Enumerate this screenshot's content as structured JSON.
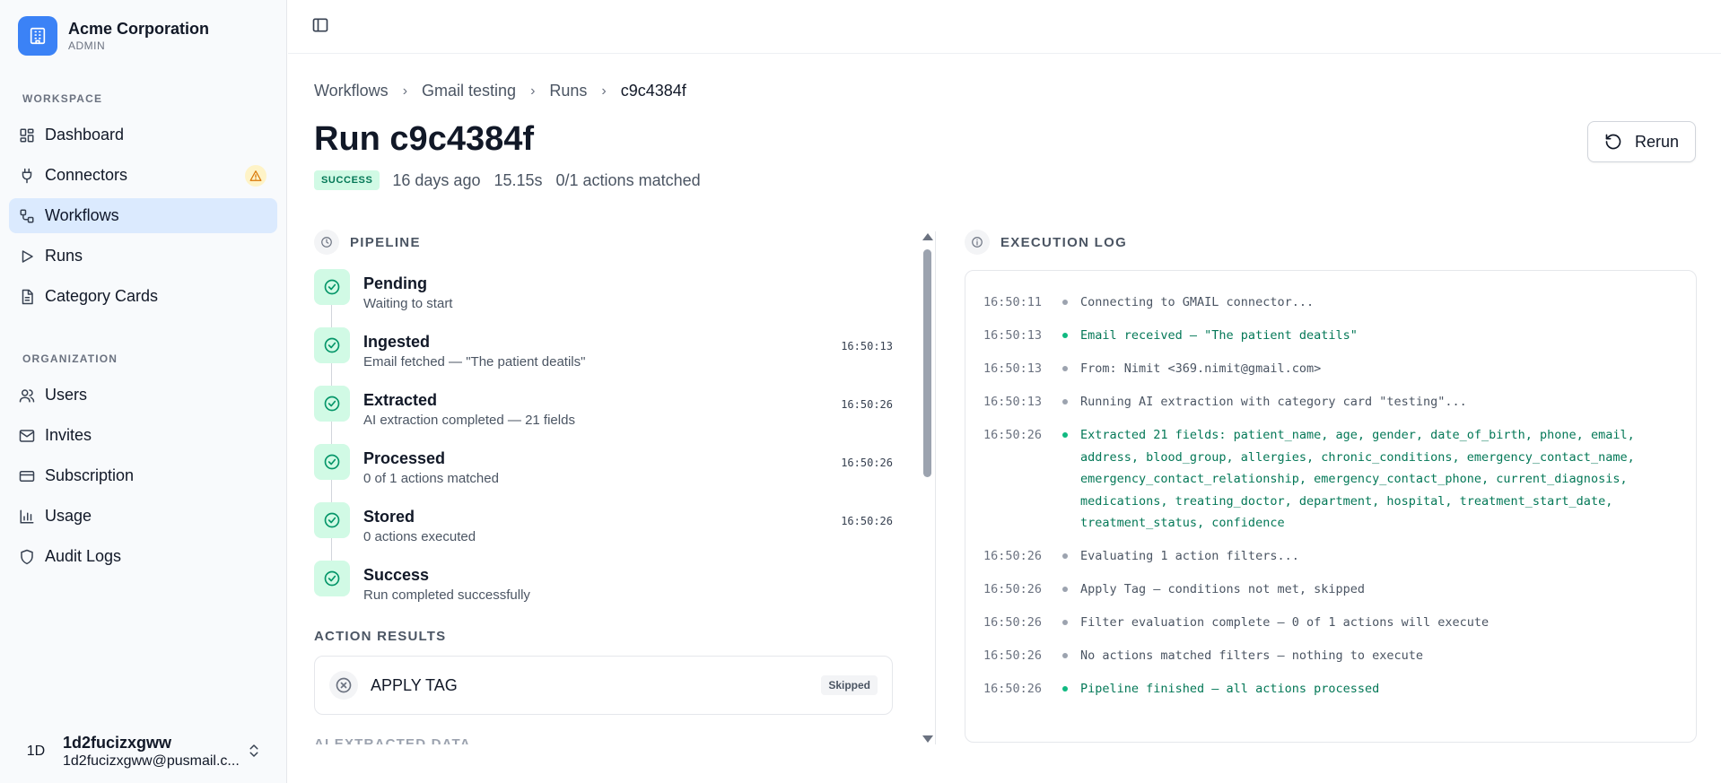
{
  "org": {
    "name": "Acme Corporation",
    "role": "ADMIN"
  },
  "sidebar": {
    "workspace_label": "WORKSPACE",
    "workspace_items": [
      {
        "label": "Dashboard",
        "icon": "dashboard-icon"
      },
      {
        "label": "Connectors",
        "icon": "plug-icon",
        "warning": true
      },
      {
        "label": "Workflows",
        "icon": "workflow-icon",
        "active": true
      },
      {
        "label": "Runs",
        "icon": "play-icon"
      },
      {
        "label": "Category Cards",
        "icon": "document-icon"
      }
    ],
    "organization_label": "ORGANIZATION",
    "organization_items": [
      {
        "label": "Users",
        "icon": "users-icon"
      },
      {
        "label": "Invites",
        "icon": "mail-icon"
      },
      {
        "label": "Subscription",
        "icon": "credit-card-icon"
      },
      {
        "label": "Usage",
        "icon": "bar-chart-icon"
      },
      {
        "label": "Audit Logs",
        "icon": "shield-icon"
      }
    ]
  },
  "user": {
    "initials": "1D",
    "name": "1d2fucizxgww",
    "email": "1d2fucizxgww@pusmail.c..."
  },
  "breadcrumb": [
    "Workflows",
    "Gmail testing",
    "Runs",
    "c9c4384f"
  ],
  "run": {
    "title": "Run c9c4384f",
    "status": "SUCCESS",
    "age": "16 days ago",
    "duration": "15.15s",
    "matched": "0/1 actions matched",
    "rerun_label": "Rerun"
  },
  "pipeline": {
    "heading": "PIPELINE",
    "stages": [
      {
        "name": "Pending",
        "sub": "Waiting to start",
        "time": ""
      },
      {
        "name": "Ingested",
        "sub": "Email fetched — \"The patient deatils\"",
        "time": "16:50:13"
      },
      {
        "name": "Extracted",
        "sub": "AI extraction completed — 21 fields",
        "time": "16:50:26"
      },
      {
        "name": "Processed",
        "sub": "0 of 1 actions matched",
        "time": "16:50:26"
      },
      {
        "name": "Stored",
        "sub": "0 actions executed",
        "time": "16:50:26"
      },
      {
        "name": "Success",
        "sub": "Run completed successfully",
        "time": ""
      }
    ]
  },
  "action_results": {
    "heading": "ACTION RESULTS",
    "items": [
      {
        "name": "APPLY TAG",
        "status": "Skipped"
      }
    ],
    "next_heading_partial": "AI EXTRACTED DATA"
  },
  "execution_log": {
    "heading": "EXECUTION LOG",
    "entries": [
      {
        "time": "16:50:11",
        "level": "info",
        "message": "Connecting to GMAIL connector..."
      },
      {
        "time": "16:50:13",
        "level": "success",
        "message": "Email received — \"The patient deatils\""
      },
      {
        "time": "16:50:13",
        "level": "info",
        "message": "From: Nimit <369.nimit@gmail.com>"
      },
      {
        "time": "16:50:13",
        "level": "info",
        "message": "Running AI extraction with category card \"testing\"..."
      },
      {
        "time": "16:50:26",
        "level": "success",
        "message": "Extracted 21 fields: patient_name, age, gender, date_of_birth, phone, email, address, blood_group, allergies, chronic_conditions, emergency_contact_name, emergency_contact_relationship, emergency_contact_phone, current_diagnosis, medications, treating_doctor, department, hospital, treatment_start_date, treatment_status, confidence"
      },
      {
        "time": "16:50:26",
        "level": "info",
        "message": "Evaluating 1 action filters..."
      },
      {
        "time": "16:50:26",
        "level": "info",
        "message": "Apply Tag — conditions not met, skipped"
      },
      {
        "time": "16:50:26",
        "level": "info",
        "message": "Filter evaluation complete — 0 of 1 actions will execute"
      },
      {
        "time": "16:50:26",
        "level": "info",
        "message": "No actions matched filters — nothing to execute"
      },
      {
        "time": "16:50:26",
        "level": "success",
        "message": "Pipeline finished — all actions processed"
      }
    ]
  },
  "colors": {
    "accent": "#3b82f6",
    "success": "#10b981",
    "success_text": "#047857",
    "warning": "#f59e0b",
    "active_nav": "#dbeafe"
  }
}
